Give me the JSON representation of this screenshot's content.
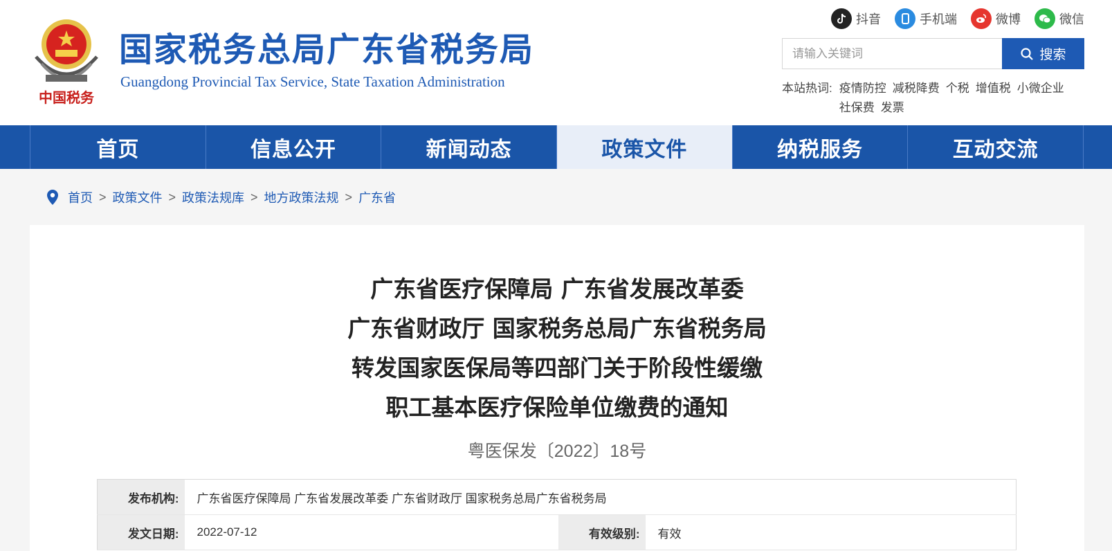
{
  "header": {
    "title": "国家税务总局广东省税务局",
    "subtitle": "Guangdong Provincial Tax Service, State Taxation Administration",
    "emblem_text": "中国税务"
  },
  "social": [
    {
      "label": "抖音",
      "icon": "douyin-icon",
      "color": "#222222"
    },
    {
      "label": "手机端",
      "icon": "mobile-icon",
      "color": "#2a8be0"
    },
    {
      "label": "微博",
      "icon": "weibo-icon",
      "color": "#e6352e"
    },
    {
      "label": "微信",
      "icon": "wechat-icon",
      "color": "#2dba4a"
    }
  ],
  "search": {
    "placeholder": "请输入关键词",
    "button_label": "搜索"
  },
  "hotwords": {
    "label": "本站热词:",
    "items": [
      "疫情防控",
      "减税降费",
      "个税",
      "增值税",
      "小微企业",
      "社保费",
      "发票"
    ]
  },
  "nav": {
    "items": [
      "首页",
      "信息公开",
      "新闻动态",
      "政策文件",
      "纳税服务",
      "互动交流"
    ],
    "active_index": 3
  },
  "breadcrumb": [
    "首页",
    "政策文件",
    "政策法规库",
    "地方政策法规",
    "广东省"
  ],
  "breadcrumb_separator": ">",
  "document": {
    "title_lines": [
      "广东省医疗保障局 广东省发展改革委",
      "广东省财政厅 国家税务总局广东省税务局",
      "转发国家医保局等四部门关于阶段性缓缴",
      "职工基本医疗保险单位缴费的通知"
    ],
    "number": "粤医保发〔2022〕18号",
    "info": {
      "publisher_label": "发布机构:",
      "publisher_value": "广东省医疗保障局 广东省发展改革委 广东省财政厅 国家税务总局广东省税务局",
      "date_label": "发文日期:",
      "date_value": "2022-07-12",
      "validity_label": "有效级别:",
      "validity_value": "有效"
    }
  },
  "colors": {
    "brand_blue": "#1e5ab4",
    "nav_active_bg": "#e8eef8"
  }
}
